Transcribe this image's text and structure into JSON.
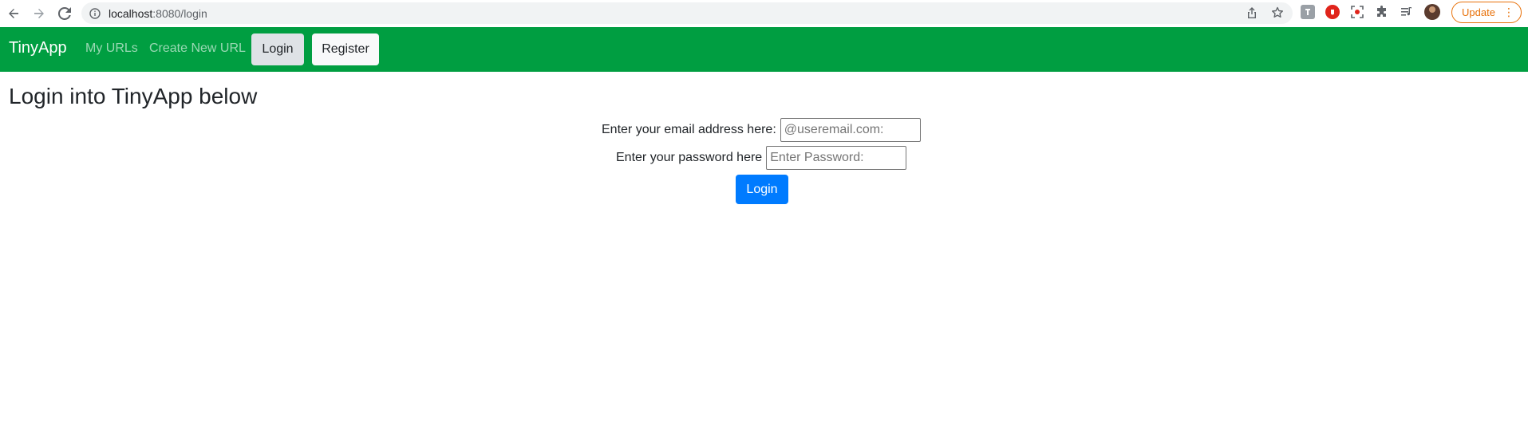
{
  "browser": {
    "url_host": "localhost",
    "url_path": ":8080/login",
    "update_label": "Update",
    "icons": [
      "back-arrow-icon",
      "forward-arrow-icon",
      "reload-icon",
      "info-icon",
      "share-icon",
      "bookmark-star-icon",
      "extension-icon",
      "adblock-icon",
      "screenshot-icon",
      "puzzle-icon",
      "reading-list-icon",
      "profile-avatar",
      "more-menu-icon"
    ]
  },
  "navbar": {
    "brand": "TinyApp",
    "links": [
      "My URLs",
      "Create New URL"
    ],
    "login_label": "Login",
    "register_label": "Register",
    "background_color": "#009e41"
  },
  "main": {
    "title": "Login into TinyApp below",
    "email": {
      "label": "Enter your email address here:",
      "placeholder": "@useremail.com:",
      "value": ""
    },
    "password": {
      "label": "Enter your password here",
      "placeholder": "Enter Password:",
      "value": ""
    },
    "submit_label": "Login",
    "submit_color": "#007bff"
  }
}
